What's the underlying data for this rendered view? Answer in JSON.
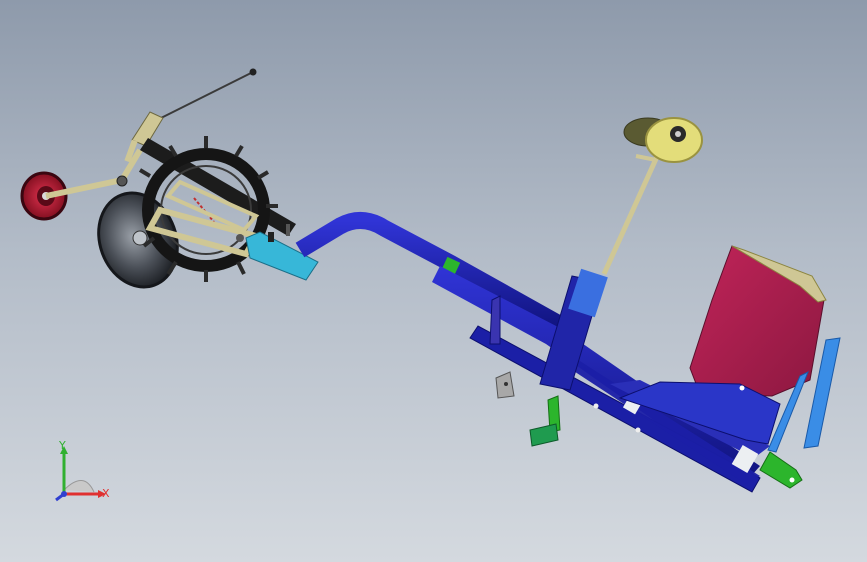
{
  "viewport": {
    "colors": {
      "frame_blue": "#1b1fa6",
      "frame_blue_dark": "#0c0f6e",
      "seat_red": "#a81f4a",
      "accent_cyan": "#37b7d8",
      "support_light_blue": "#3a8de6",
      "lever_green": "#2cb52c",
      "tan": "#cfc795",
      "wheel_red": "#b5122c",
      "wheel_dark": "#222222",
      "steering_yellow": "#e3dd7a"
    }
  },
  "triad": {
    "x_label": "X",
    "y_label": "Y",
    "x_color": "#e03030",
    "y_color": "#30b030",
    "z_color": "#3040d0"
  },
  "model_parts": [
    "front-wheel",
    "paddle-drive-wheel",
    "cutting-disc",
    "gearbox-frame",
    "tow-rod",
    "main-frame",
    "steering-column",
    "steering-wheel",
    "seat",
    "rear-support",
    "foot-lever"
  ]
}
